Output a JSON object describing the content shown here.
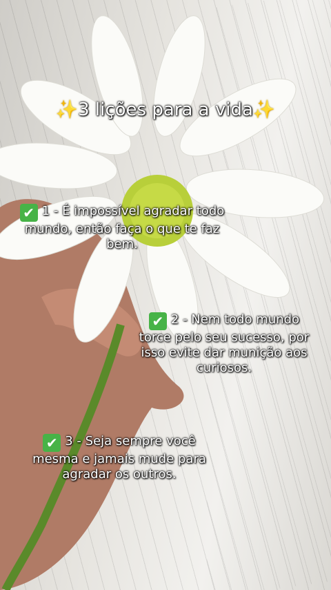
{
  "title": {
    "text": "3 lições para a vida",
    "emoji": "✨"
  },
  "lessons": [
    {
      "number": "1",
      "text": "1 - É impossível agradar todo mundo, então faça o que te faz bem.",
      "emoji": "✔"
    },
    {
      "number": "2",
      "text": "2 - Nem todo mundo torce pelo seu sucesso, por isso evite dar munição aos curiosos.",
      "emoji": "✔"
    },
    {
      "number": "3",
      "text": "3 - Seja sempre você mesma e jamais mude para agradar os outros.",
      "emoji": "✔"
    }
  ],
  "colors": {
    "check_bg": "#47b347",
    "sparkle": "#ffd43a",
    "daisy_center": "#b8cf3a",
    "stem": "#5a8a2a"
  }
}
